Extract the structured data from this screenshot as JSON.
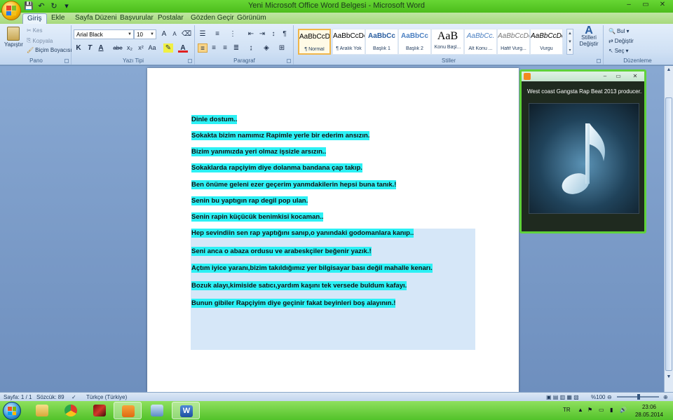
{
  "window": {
    "title": "Yeni Microsoft Office Word Belgesi - Microsoft Word",
    "controls": [
      "–",
      "▭",
      "✕"
    ]
  },
  "quick_access": {
    "icons": [
      "save-icon",
      "undo-icon",
      "redo-icon"
    ]
  },
  "tabs": [
    "Giriş",
    "Ekle",
    "Sayfa Düzeni",
    "Başvurular",
    "Postalar",
    "Gözden Geçir",
    "Görünüm"
  ],
  "ribbon": {
    "clipboard": {
      "label": "Pano",
      "paste": "Yapıştır",
      "cut": "Kes",
      "copy": "Kopyala",
      "format_painter": "Biçim Boyacısı"
    },
    "font": {
      "label": "Yazı Tipi",
      "font_name": "Arial Black",
      "font_size": "10",
      "grow": "A",
      "shrink": "A",
      "bold": "K",
      "italic": "T",
      "underline": "A",
      "strike": "abe",
      "subscript": "x₂",
      "superscript": "x²",
      "change_case": "Aa",
      "font_color": "A"
    },
    "paragraph": {
      "label": "Paragraf"
    },
    "styles": {
      "label": "Stiller",
      "items": [
        {
          "sample": "AaBbCcDc",
          "name": "¶ Normal"
        },
        {
          "sample": "AaBbCcDc",
          "name": "¶ Aralık Yok"
        },
        {
          "sample": "AaBbCc",
          "name": "Başlık 1"
        },
        {
          "sample": "AaBbCc",
          "name": "Başlık 2"
        },
        {
          "sample": "AaB",
          "name": "Konu Başl..."
        },
        {
          "sample": "AaBbCc.",
          "name": "Alt Konu ..."
        },
        {
          "sample": "AaBbCcDc",
          "name": "Hafif Vurg..."
        },
        {
          "sample": "AaBbCcDc",
          "name": "Vurgu"
        }
      ],
      "change": "Stilleri Değiştir"
    },
    "editing": {
      "label": "Düzenleme",
      "find": "Bul",
      "replace": "Değiştir",
      "select": "Seç"
    }
  },
  "document": {
    "lines": [
      "Dinle dostum..",
      "Sokakta bizim namımız Rapimle yerle bir ederim ansızın.",
      "Bizim yanımızda yeri olmaz işsizle arsızın..",
      "Sokaklarda rapçiyim diye dolanma bandana çap takıp.",
      "Ben önüme geleni ezer geçerim yanmdakilerin hepsi buna tanık.!",
      "Senin bu yaptıgın rap degil pop ulan.",
      "Senin rapin küçücük benimkisi kocaman..",
      "Hep sevindiin sen rap yaptığını sanıp,o yanındaki godomanlara kanıp..",
      " Seni anca o abaza ordusu ve arabeskçiler beğenir yazık.!",
      "Açtım iyice yaranı,bizim takıldığımız yer bilgisayar bası değil mahalle kenarı.",
      "Bozuk alayı,kimiside satıcı,yardım kaşını tek versede buldum kafayı.",
      "Bunun gibiler Rapçiyim diye geçinir fakat beyinleri boş alayının.!"
    ]
  },
  "player": {
    "track_title": "West coast Gangsta Rap Beat 2013 producer...",
    "art_icon": "music-note-icon"
  },
  "status": {
    "page": "Sayfa: 1 / 1",
    "words": "Sözcük: 89",
    "language": "Türkçe (Türkiye)",
    "zoom": "%100"
  },
  "taskbar": {
    "apps": [
      "explorer-icon",
      "chrome-icon",
      "game-icon",
      "media-player-icon",
      "network-icon",
      "word-icon"
    ],
    "language": "TR",
    "time": "23:06",
    "date": "28.05.2014"
  },
  "colors": {
    "highlight": "#2cf1f5",
    "title_green": "#4cbd1c",
    "selection": "#d6e7f8"
  }
}
